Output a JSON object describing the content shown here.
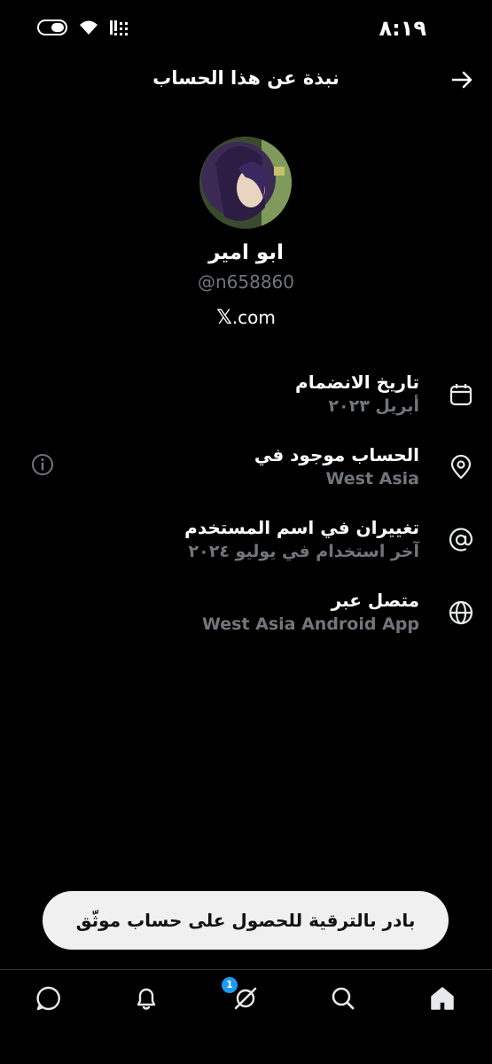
{
  "status": {
    "time": "٨:١٩"
  },
  "header": {
    "title": "نبذة عن هذا الحساب"
  },
  "profile": {
    "display_name": "ابو امير",
    "handle": "@n658860",
    "site_prefix": "𝕏",
    "site_suffix": ".com"
  },
  "rows": [
    {
      "title": "تاريخ الانضمام",
      "sub": "أبريل ٢٠٢٣",
      "icon": "calendar-icon"
    },
    {
      "title": "الحساب موجود في",
      "sub": "West Asia",
      "icon": "location-pin-icon"
    },
    {
      "title": "تغييران في اسم المستخدم",
      "sub": "آخر استخدام في يوليو ٢٠٢٤",
      "icon": "at-sign-icon"
    },
    {
      "title": "متصل عبر",
      "sub": "West Asia Android App",
      "icon": "globe-icon"
    }
  ],
  "upgrade": {
    "label": "بادر بالترقية للحصول على حساب موثّق"
  },
  "nav": {
    "badge_count": "1"
  },
  "colors": {
    "background": "#000000",
    "secondary_text": "#71767b",
    "badge": "#1d9bf0"
  }
}
